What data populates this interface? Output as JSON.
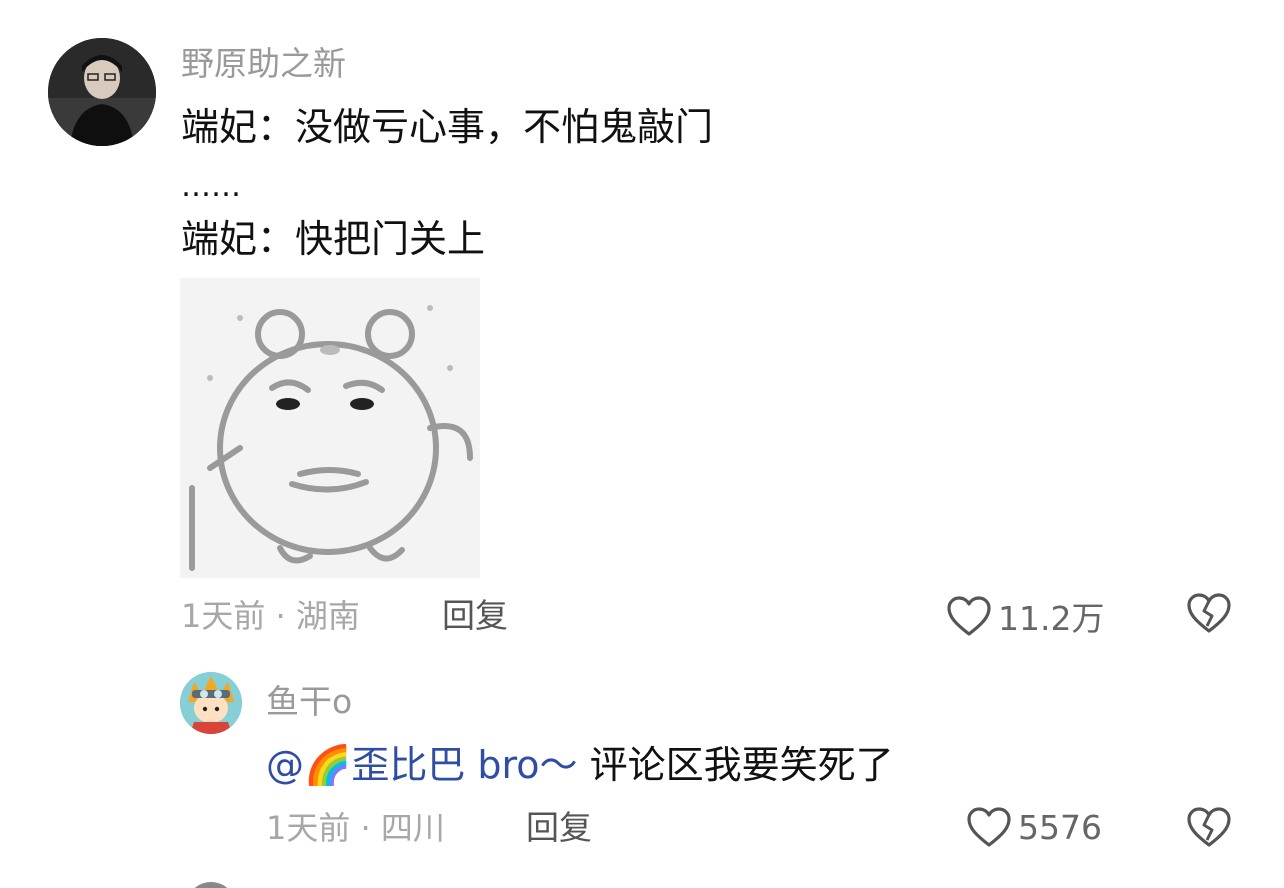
{
  "comments": [
    {
      "username": "野原助之新",
      "lines": [
        "端妃：没做亏心事，不怕鬼敲门",
        "……",
        "端妃：快把门关上"
      ],
      "time_location": "1天前 · 湖南",
      "reply_label": "回复",
      "likes": "11.2万",
      "avatar_icon": "person-photo-avatar",
      "sticker_icon": "bear-meme-sticker"
    },
    {
      "username": "鱼干o",
      "mention": "@🌈歪比巴 bro～",
      "text": " 评论区我要笑死了",
      "time_location": "1天前 · 四川",
      "reply_label": "回复",
      "likes": "5576",
      "avatar_icon": "cartoon-ninja-avatar"
    }
  ],
  "colors": {
    "mention": "#2f4ea3",
    "meta": "#a7a7a7",
    "username": "#9a9a9a"
  }
}
